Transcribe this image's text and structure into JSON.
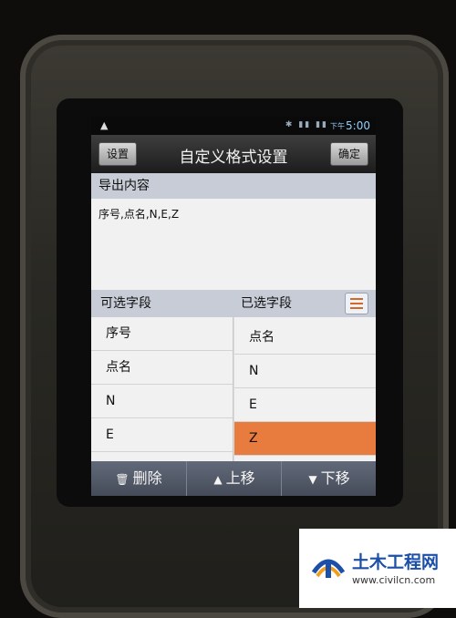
{
  "status_bar": {
    "warning_icon": "warning-triangle-icon",
    "ampm": "下午",
    "time": "5:00"
  },
  "title_bar": {
    "left_button": "设置",
    "title": "自定义格式设置",
    "right_button": "确定"
  },
  "output": {
    "header": "导出内容",
    "value": "序号,点名,N,E,Z"
  },
  "fields": {
    "available_header": "可选字段",
    "selected_header": "已选字段",
    "available": [
      "序号",
      "点名",
      "N",
      "E"
    ],
    "selected": [
      "点名",
      "N",
      "E",
      "Z"
    ],
    "selected_highlight_index": 3
  },
  "bottom_bar": {
    "delete": "删除",
    "move_up": "上移",
    "move_down": "下移"
  },
  "watermark": {
    "name": "土木工程网",
    "url": "www.civilcn.com"
  },
  "colors": {
    "highlight": "#e87b3e",
    "header_bg": "#c7ccd6",
    "bottom_bar": "#4f5666"
  }
}
